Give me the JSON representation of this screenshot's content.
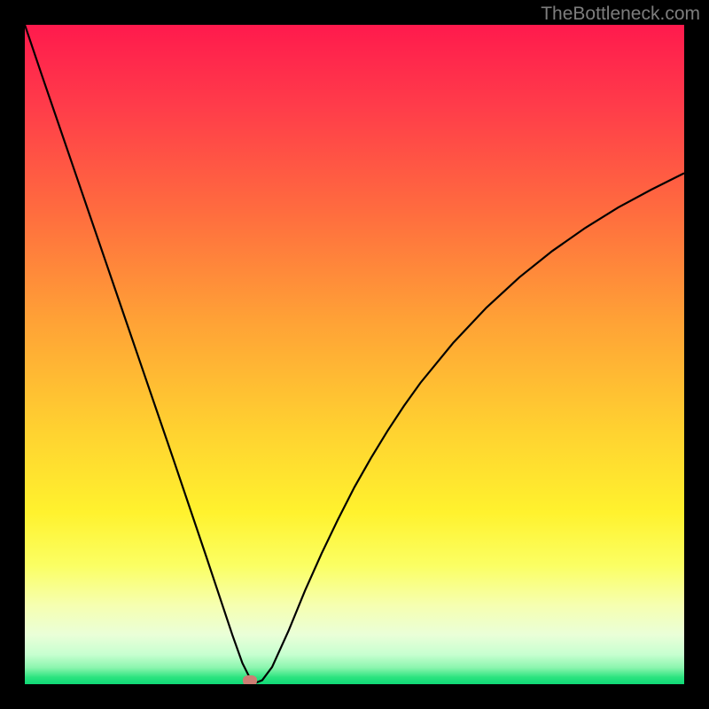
{
  "watermark_text": "TheBottleneck.com",
  "chart_data": {
    "type": "line",
    "title": "",
    "xlabel": "",
    "ylabel": "",
    "x_range": [
      0,
      100
    ],
    "y_range": [
      0,
      100
    ],
    "gradient_stops": [
      {
        "pos": 0.0,
        "color": "#ff1a4d"
      },
      {
        "pos": 0.12,
        "color": "#ff3b4a"
      },
      {
        "pos": 0.28,
        "color": "#ff6b3f"
      },
      {
        "pos": 0.45,
        "color": "#ffa236"
      },
      {
        "pos": 0.62,
        "color": "#ffd330"
      },
      {
        "pos": 0.74,
        "color": "#fff22e"
      },
      {
        "pos": 0.82,
        "color": "#fbff63"
      },
      {
        "pos": 0.88,
        "color": "#f6ffb0"
      },
      {
        "pos": 0.925,
        "color": "#eaffd8"
      },
      {
        "pos": 0.955,
        "color": "#c7ffd0"
      },
      {
        "pos": 0.975,
        "color": "#8bf5ae"
      },
      {
        "pos": 0.99,
        "color": "#29e37e"
      },
      {
        "pos": 1.0,
        "color": "#10d877"
      }
    ],
    "series": [
      {
        "name": "bottleneck-curve",
        "stroke": "#000000",
        "stroke_width": 2.2,
        "x": [
          0.0,
          2.5,
          5.0,
          7.5,
          10.0,
          12.5,
          15.0,
          17.5,
          20.0,
          22.5,
          25.0,
          27.5,
          30.0,
          31.5,
          33.0,
          34.0,
          35.0,
          36.0,
          37.5,
          40.0,
          42.5,
          45.0,
          47.5,
          50.0,
          52.5,
          55.0,
          57.5,
          60.0,
          65.0,
          70.0,
          75.0,
          80.0,
          85.0,
          90.0,
          95.0,
          100.0
        ],
        "y": [
          100.0,
          92.6,
          85.3,
          78.0,
          70.7,
          63.4,
          56.1,
          48.8,
          41.5,
          34.2,
          26.8,
          19.4,
          11.9,
          7.4,
          3.2,
          1.2,
          0.2,
          0.6,
          2.6,
          8.1,
          14.2,
          19.8,
          25.0,
          29.9,
          34.3,
          38.4,
          42.2,
          45.7,
          51.8,
          57.1,
          61.7,
          65.7,
          69.2,
          72.3,
          75.0,
          77.5
        ]
      }
    ],
    "marker": {
      "x": 34.2,
      "y": 0.5,
      "color": "#cd7e74"
    }
  }
}
